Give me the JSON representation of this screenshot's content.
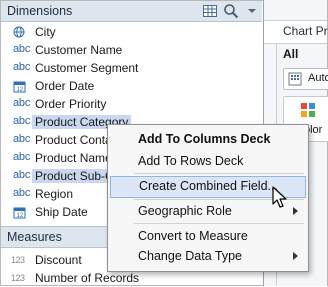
{
  "dimensions": {
    "title": "Dimensions",
    "items": [
      {
        "label": "City",
        "icon": "globe-icon",
        "type": "geo"
      },
      {
        "label": "Customer Name",
        "icon": "abc-string-icon",
        "type": "abc"
      },
      {
        "label": "Customer Segment",
        "icon": "abc-string-icon",
        "type": "abc"
      },
      {
        "label": "Order Date",
        "icon": "calendar-icon",
        "type": "date"
      },
      {
        "label": "Order Priority",
        "icon": "abc-string-icon",
        "type": "abc"
      },
      {
        "label": "Product Category",
        "icon": "abc-string-icon",
        "type": "abc",
        "selected": true
      },
      {
        "label": "Product Conta",
        "icon": "abc-string-icon",
        "type": "abc"
      },
      {
        "label": "Product Name",
        "icon": "abc-string-icon",
        "type": "abc"
      },
      {
        "label": "Product Sub-C",
        "icon": "abc-string-icon",
        "type": "abc",
        "selected": true
      },
      {
        "label": "Region",
        "icon": "abc-string-icon",
        "type": "abc"
      },
      {
        "label": "Ship Date",
        "icon": "calendar-icon",
        "type": "date"
      }
    ],
    "abc_text": "abc"
  },
  "measures": {
    "title": "Measures",
    "items": [
      {
        "label": "Discount",
        "icon": "number-icon"
      },
      {
        "label": "Number of Records",
        "icon": "number-icon"
      }
    ],
    "num_text": "123"
  },
  "right_panel": {
    "title": "Chart Pro",
    "all_label": "All",
    "auto_label": "Auto",
    "color_label": "olor"
  },
  "context_menu": {
    "items": [
      {
        "label": "Add To Columns Deck",
        "bold": true
      },
      {
        "label": "Add To Rows Deck"
      },
      {
        "label": "Create Combined Field...",
        "highlighted": true
      },
      {
        "label": "Geographic Role",
        "submenu": true
      },
      {
        "label": "Convert to Measure"
      },
      {
        "label": "Change Data Type",
        "submenu": true
      }
    ]
  },
  "colors": {
    "header_bg": "#dde5ef",
    "selection": "#c9d8ee",
    "menu_highlight": "#dbe7f6",
    "icon_blue": "#2a64a8"
  }
}
